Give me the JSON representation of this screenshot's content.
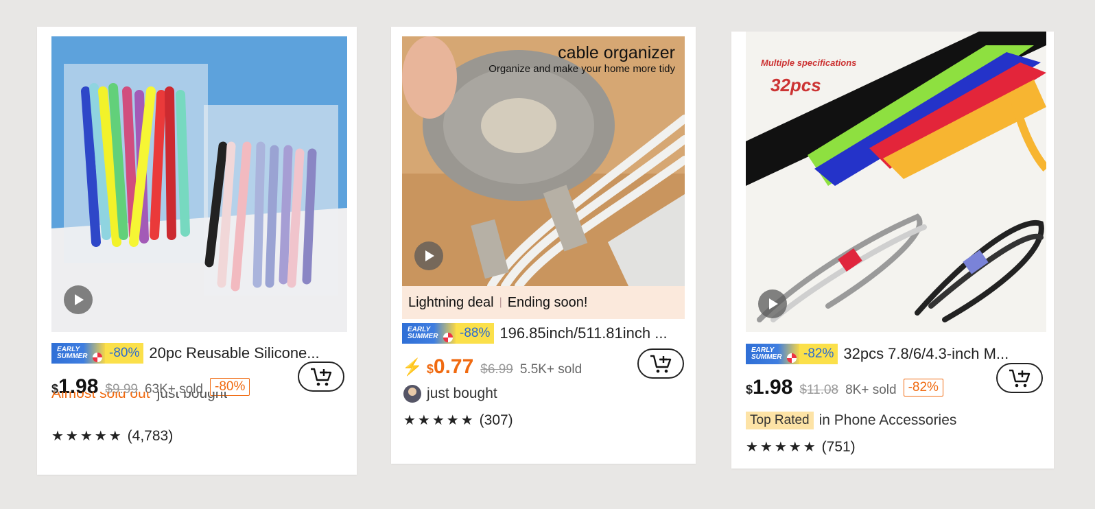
{
  "cards": [
    {
      "badge": {
        "early": "EARLY",
        "summer": "SUMMER",
        "pct": "-80%"
      },
      "title": "20pc Reusable Silicone...",
      "currency": "$",
      "price": "1.98",
      "old_price": "$9.99",
      "sold": "63K+ sold",
      "discount": "-80%",
      "partial_text": "Almost sold out",
      "partial_text2": "just bought",
      "rating_count": "(4,783)"
    },
    {
      "img_title": "cable organizer",
      "img_subtitle": "Organize and make your home more tidy",
      "deal_left": "Lightning deal",
      "deal_sep": "|",
      "deal_right": "Ending soon!",
      "badge": {
        "early": "EARLY",
        "summer": "SUMMER",
        "pct": "-88%"
      },
      "title": "196.85inch/511.81inch ...",
      "currency": "$",
      "price": "0.77",
      "old_price": "$6.99",
      "sold": "5.5K+ sold",
      "buyer_text": "just bought",
      "rating_count": "(307)"
    },
    {
      "img_spec1": "Multiple specifications",
      "img_spec2": "32pcs",
      "badge": {
        "early": "EARLY",
        "summer": "SUMMER",
        "pct": "-82%"
      },
      "title": "32pcs 7.8/6/4.3-inch M...",
      "currency": "$",
      "price": "1.98",
      "old_price": "$11.08",
      "sold": "8K+ sold",
      "discount": "-82%",
      "top_rated": "Top Rated",
      "category": "in Phone Accessories",
      "rating_count": "(751)"
    }
  ],
  "stars": "★★★★★",
  "icons": {
    "play": "play-icon",
    "cart": "add-to-cart-icon",
    "bolt": "lightning-icon"
  },
  "colors": {
    "accent": "#f06a10",
    "badge_blue": "#2a6ad1",
    "badge_yellow": "#fbe04a"
  }
}
